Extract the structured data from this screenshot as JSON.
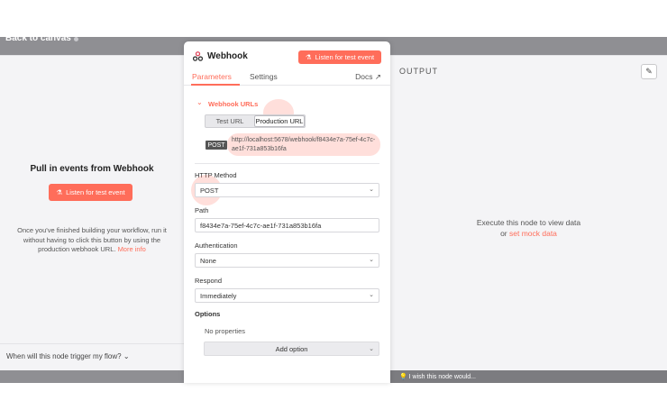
{
  "canvas": {
    "back_label": "Back to canvas"
  },
  "left_panel": {
    "title": "Pull in events from Webhook",
    "listen_button": "Listen for test event",
    "description": "Once you've finished building your workflow, run it without having to click this button by using the production webhook URL.",
    "more_info": "More info",
    "footer": "When will this node trigger my flow?"
  },
  "node_panel": {
    "title": "Webhook",
    "listen_button": "Listen for test event",
    "tabs": [
      "Parameters",
      "Settings"
    ],
    "docs_label": "Docs",
    "webhook_urls": {
      "section_title": "Webhook URLs",
      "toggle": [
        "Test URL",
        "Production URL"
      ],
      "selected": "Production URL",
      "method_badge": "POST",
      "url": "http://localhost:5678/webhook/f8434e7a-75ef-4c7c-ae1f-731a853b16fa"
    },
    "http_method": {
      "label": "HTTP Method",
      "value": "POST"
    },
    "path": {
      "label": "Path",
      "value": "f8434e7a-75ef-4c7c-ae1f-731a853b16fa"
    },
    "authentication": {
      "label": "Authentication",
      "value": "None"
    },
    "respond": {
      "label": "Respond",
      "value": "Immediately"
    },
    "options": {
      "label": "Options",
      "empty_text": "No properties",
      "add_button": "Add option"
    }
  },
  "output_panel": {
    "title": "OUTPUT",
    "message": "Execute this node to view data",
    "or_text": "or",
    "mock_link": "set mock data"
  },
  "wish_bar": {
    "text": "I wish this node would..."
  },
  "colors": {
    "accent": "#ff6d5a",
    "overlay": "#8f8f93",
    "panel_bg": "#f4f4f6"
  }
}
